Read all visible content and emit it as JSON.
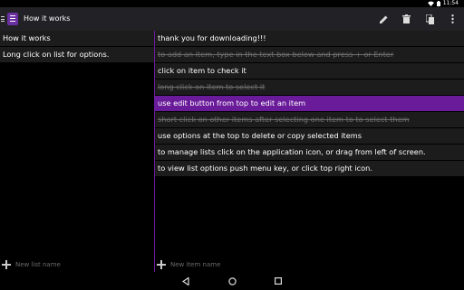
{
  "status_bar": {
    "time": "11:54"
  },
  "app": {
    "title": "How it works"
  },
  "lists": [
    {
      "label": "How it works"
    },
    {
      "label": "Long click on list for options."
    }
  ],
  "items": [
    {
      "label": "thank you for downloading!!!",
      "state": "normal"
    },
    {
      "label": "to add an item, type in the text box below and press + or Enter",
      "state": "checked"
    },
    {
      "label": "click on item to check it",
      "state": "normal"
    },
    {
      "label": "long click on item to select it",
      "state": "checked"
    },
    {
      "label": "use edit button from top to edit an item",
      "state": "selected"
    },
    {
      "label": "short click on other items after selecting one item to to select them",
      "state": "checked"
    },
    {
      "label": "use options at the top to delete or copy selected items",
      "state": "normal"
    },
    {
      "label": "to manage lists click on the application icon, or drag from left of screen.",
      "state": "normal"
    },
    {
      "label": "to view list options push menu key, or click top right icon.",
      "state": "normal"
    }
  ],
  "new_list": {
    "placeholder": "New list name",
    "value": ""
  },
  "new_item": {
    "placeholder": "New item name",
    "value": ""
  },
  "toolbar": {
    "icons": [
      "pencil-icon",
      "trash-icon",
      "copy-icon",
      "overflow-menu-icon"
    ]
  },
  "colors": {
    "accent": "#6a1b9a",
    "row_bg": "#1c1c1c",
    "actionbar_bg": "#222226",
    "checked_text": "#6e6e6e"
  }
}
